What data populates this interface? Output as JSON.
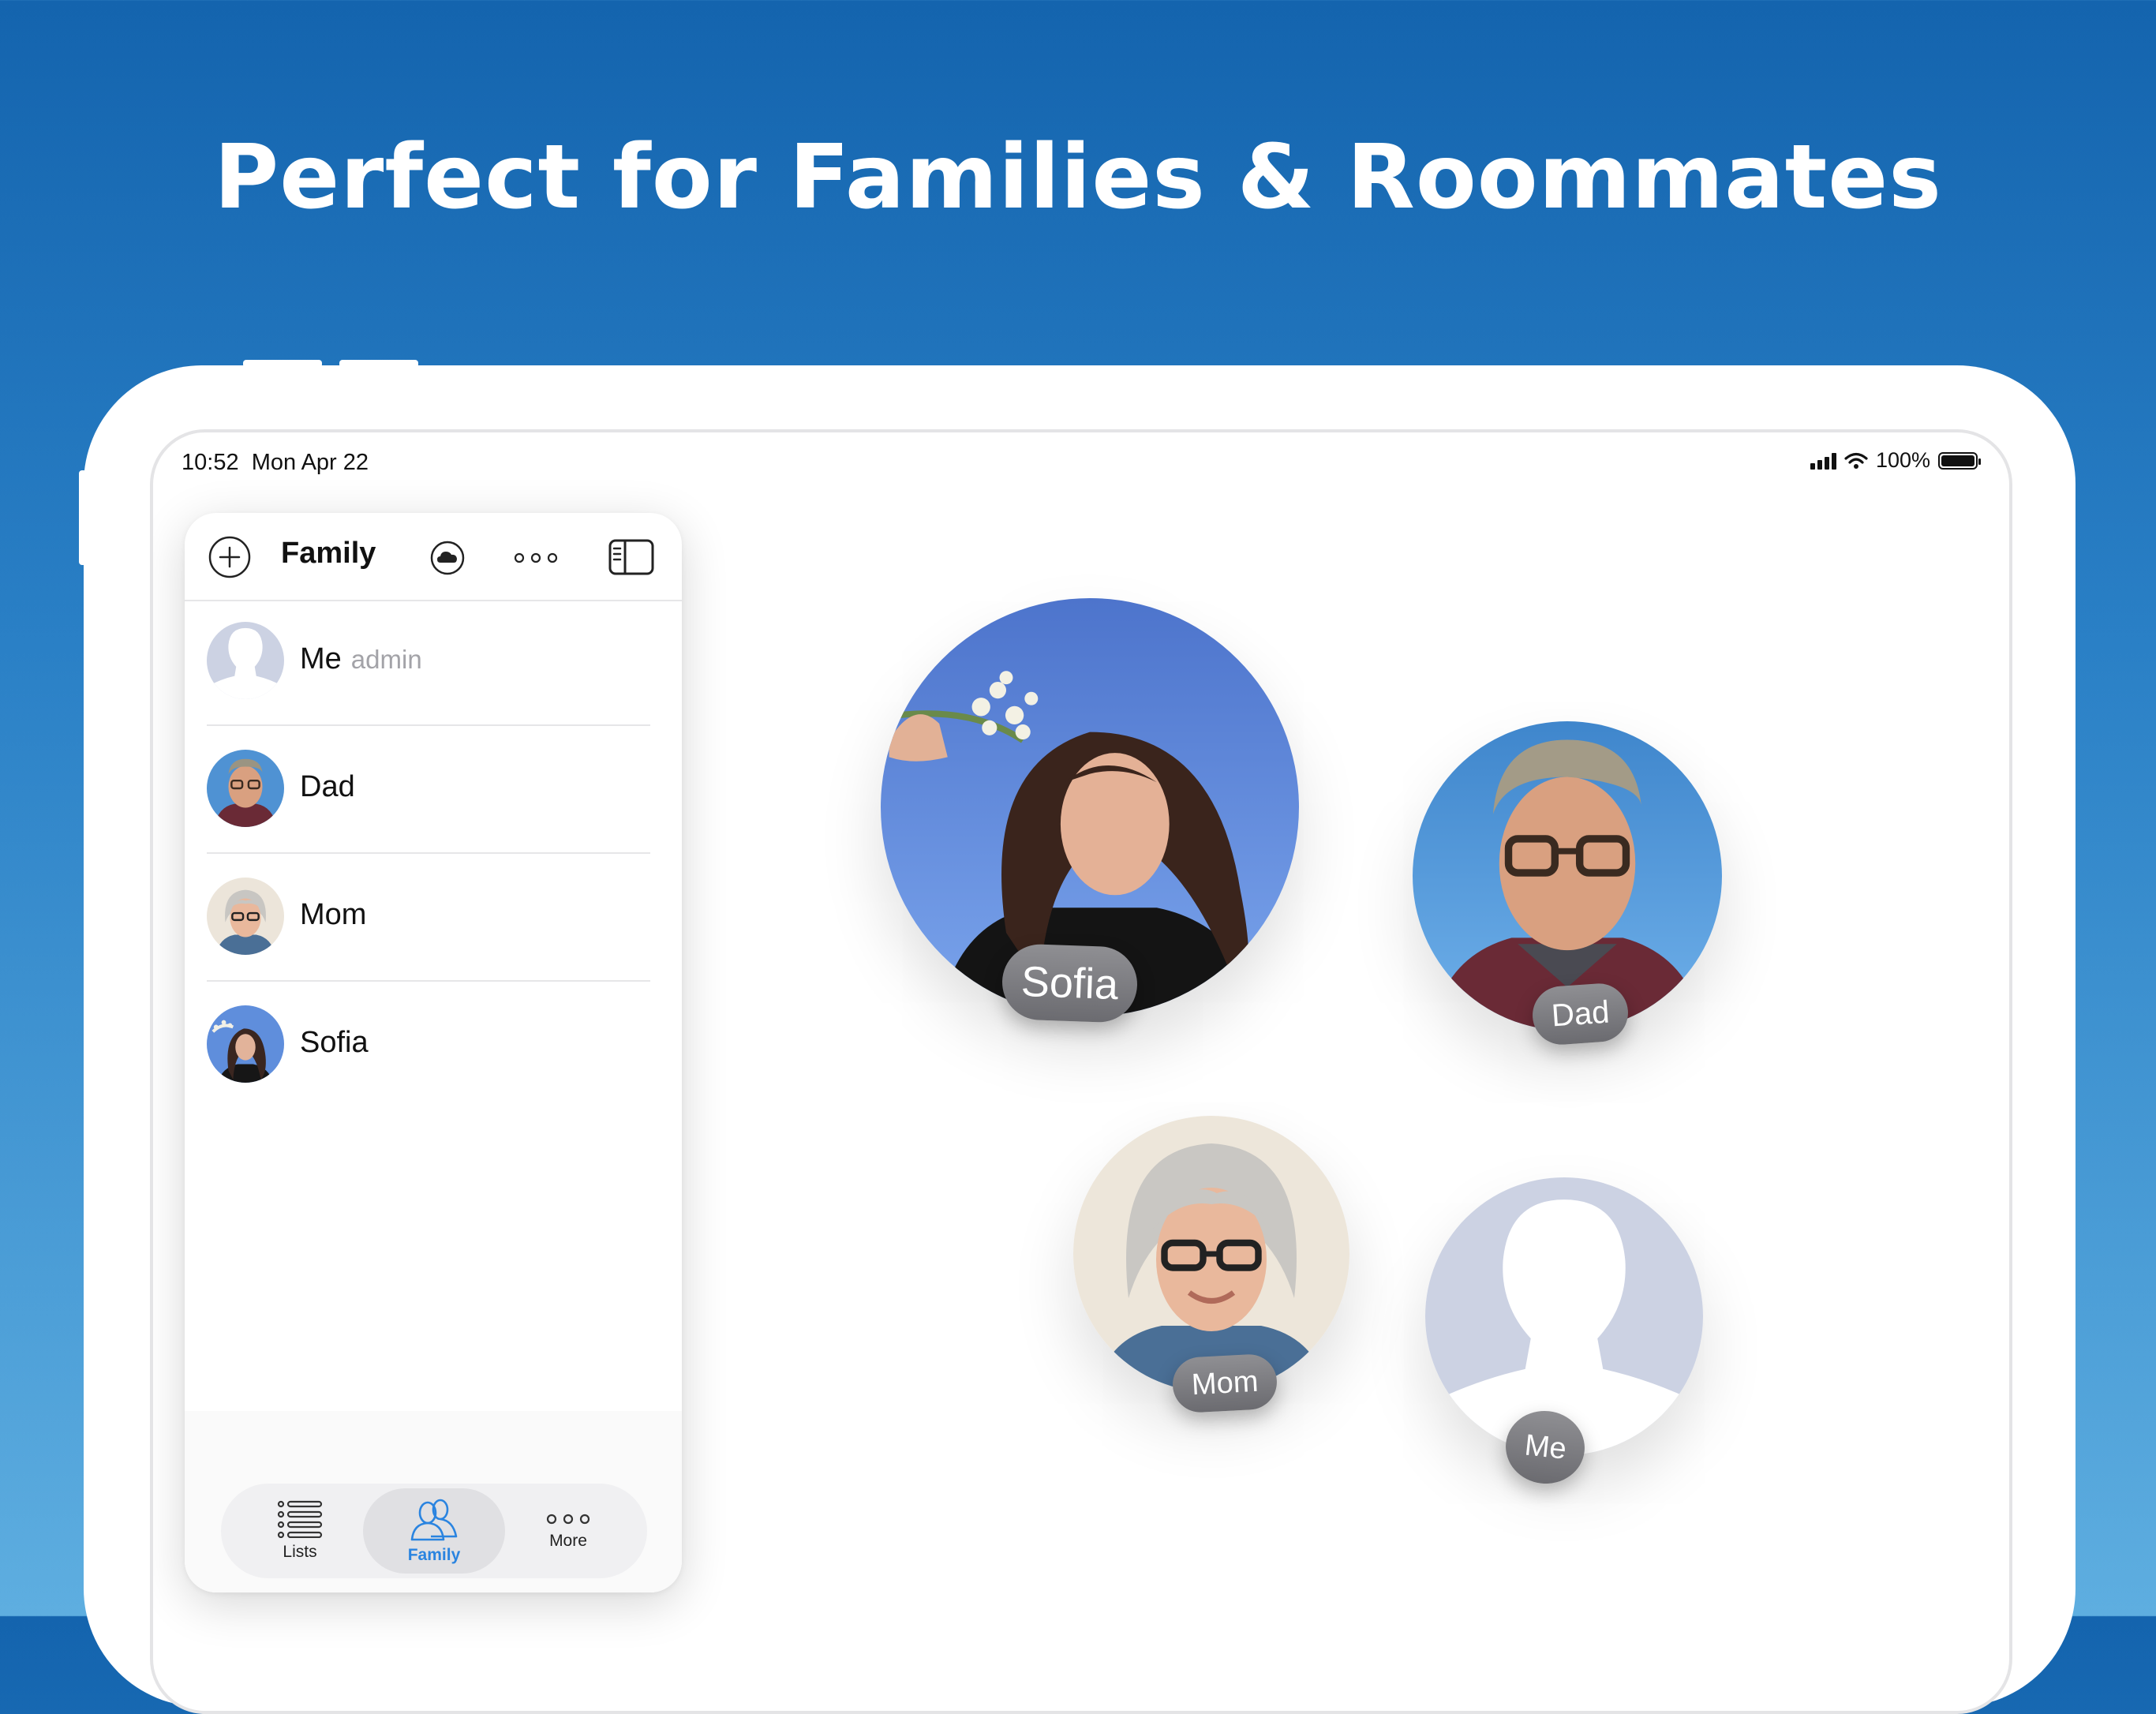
{
  "headline": "Perfect for Families & Roommates",
  "status_bar": {
    "time": "10:52",
    "date": "Mon Apr 22",
    "battery": "100%"
  },
  "sidebar": {
    "title": "Family",
    "members": [
      {
        "name": "Me",
        "tag": "admin",
        "avatar": "silhouette"
      },
      {
        "name": "Dad",
        "tag": "",
        "avatar": "photo"
      },
      {
        "name": "Mom",
        "tag": "",
        "avatar": "photo"
      },
      {
        "name": "Sofia",
        "tag": "",
        "avatar": "photo"
      }
    ]
  },
  "tabs": [
    {
      "label": "Lists",
      "icon": "list-icon",
      "active": false
    },
    {
      "label": "Family",
      "icon": "people-icon",
      "active": true
    },
    {
      "label": "More",
      "icon": "ellipsis-icon",
      "active": false
    }
  ],
  "bubbles": [
    {
      "name": "Sofia"
    },
    {
      "name": "Dad"
    },
    {
      "name": "Mom"
    },
    {
      "name": "Me"
    }
  ],
  "colors": {
    "background_top": "#1464ae",
    "background_bottom": "#5eaee0",
    "accent": "#2a84e0",
    "silhouette": "#ccd2e3"
  }
}
